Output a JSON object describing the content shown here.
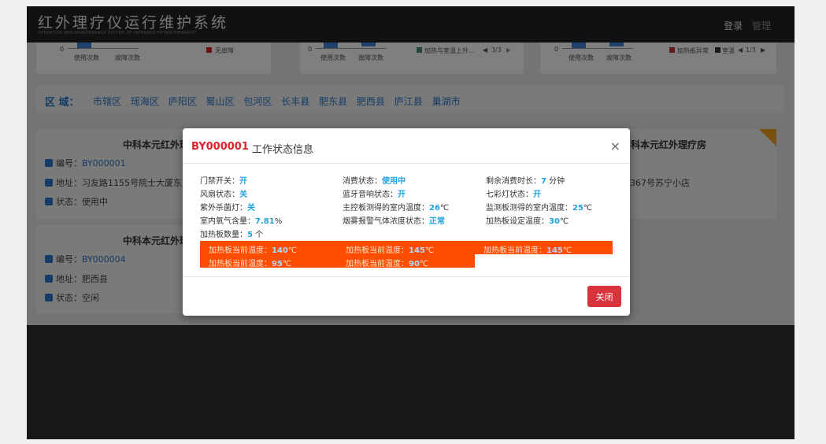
{
  "app": {
    "title": "红外理疗仪运行维护系统",
    "subtitle": "OPERATION AND MAINTENANCE SYSTEM OF INFRARED PHYSIOTHERAPIST",
    "nav_login": "登录",
    "nav_manage": "管理"
  },
  "stat_cards": [
    {
      "zero": "0",
      "label_use": "使用次数",
      "label_fault": "故障次数",
      "legend": "无故障"
    },
    {
      "zero": "0",
      "label_use": "使用次数",
      "label_fault": "故障次数",
      "legend": "加热与室温上升...",
      "pager": "3/3"
    },
    {
      "zero": "0",
      "label_use": "使用次数",
      "label_fault": "故障次数",
      "legend1": "加热板异常",
      "legend2": "室温",
      "pager": "1/3"
    }
  ],
  "region": {
    "label": "区 域：",
    "items": [
      "市辖区",
      "瑶海区",
      "庐阳区",
      "蜀山区",
      "包河区",
      "长丰县",
      "肥东县",
      "肥西县",
      "庐江县",
      "巢湖市"
    ]
  },
  "devices": [
    {
      "title": "中科本元红外理疗",
      "code_label": "编号：",
      "code": "BY000001",
      "addr_label": "地址：",
      "addr": "习友路1155号院士大厦东",
      "status_label": "状态：",
      "status": "使用中"
    },
    {
      "title": "中科本元红外理疗",
      "code_label": "编号：",
      "code": "BY000004",
      "addr_label": "地址：",
      "addr": "肥西县",
      "status_label": "状态：",
      "status": "空闲"
    },
    {
      "title": "科本元红外理疗房",
      "addr": "367号苏宁小店"
    }
  ],
  "modal": {
    "code": "BY000001",
    "title": "工作状态信息",
    "close_x": "×",
    "fields": {
      "door_label": "门禁开关：",
      "door": "开",
      "consume_label": "消费状态：",
      "consume": "使用中",
      "remain_label": "剩余消费时长：",
      "remain": "7",
      "remain_unit": " 分钟",
      "fan_label": "风扇状态：",
      "fan": "关",
      "bt_label": "蓝牙音响状态：",
      "bt": "开",
      "rgb_label": "七彩灯状态：",
      "rgb": "开",
      "uv_label": "紫外杀菌灯：",
      "uv": "关",
      "main_temp_label": "主控板测得的室内温度：",
      "main_temp": "26",
      "main_temp_unit": "℃",
      "mon_temp_label": "监测板测得的室内温度：",
      "mon_temp": "25",
      "mon_temp_unit": "℃",
      "oxy_label": "室内氧气含量：",
      "oxy": "7.81",
      "oxy_unit": "%",
      "smoke_label": "烟雾报警气体浓度状态：",
      "smoke": "正常",
      "set_temp_label": "加热板设定温度：",
      "set_temp": "30",
      "set_temp_unit": "℃",
      "count_label": "加热板数量：",
      "count": "5",
      "count_unit": " 个"
    },
    "heat_label": "加热板当前温度：",
    "heat_unit": "℃",
    "heat_values": [
      "140",
      "145",
      "145",
      "95",
      "90"
    ],
    "close_button": "关闭"
  }
}
